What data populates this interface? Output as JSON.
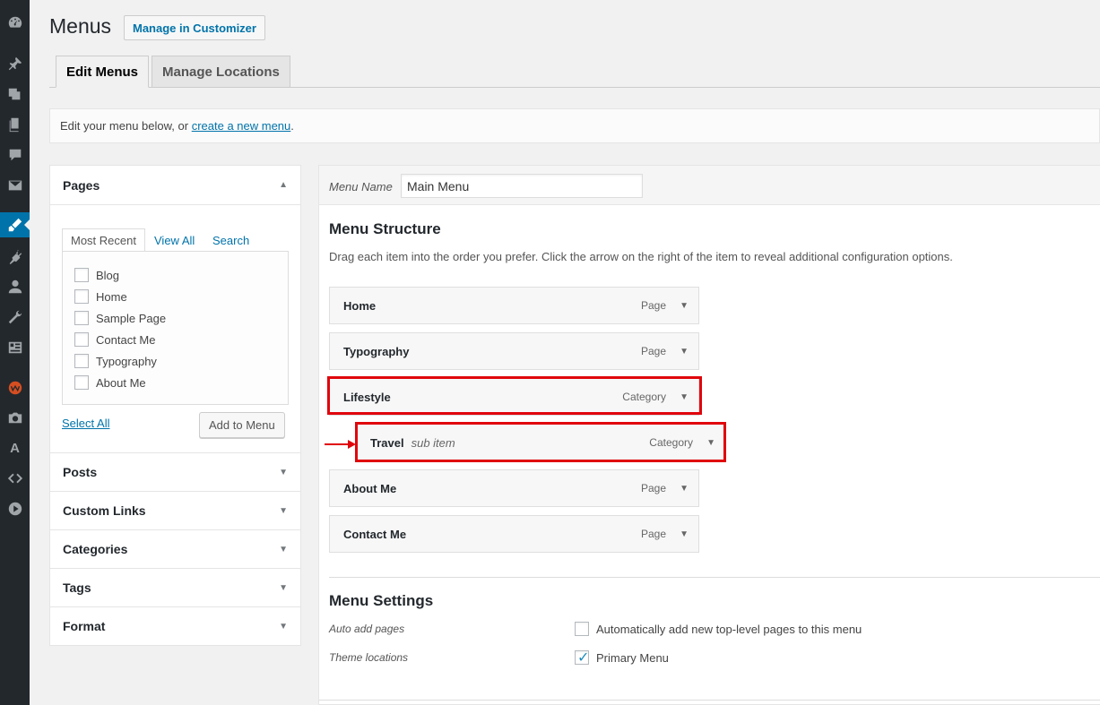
{
  "header": {
    "title": "Menus",
    "customizer_button": "Manage in Customizer"
  },
  "tabs": [
    {
      "label": "Edit Menus",
      "active": true
    },
    {
      "label": "Manage Locations",
      "active": false
    }
  ],
  "notice": {
    "prefix": "Edit your menu below, or ",
    "link": "create a new menu",
    "suffix": "."
  },
  "sidebar": {
    "icons": [
      "dashboard-icon",
      "pin-icon",
      "media-icon",
      "pages-icon",
      "comments-icon",
      "mail-icon",
      "appearance-icon",
      "plugins-icon",
      "users-icon",
      "tools-icon",
      "settings-icon",
      "plugin-badge-icon",
      "camera-icon",
      "font-icon",
      "code-icon",
      "play-icon"
    ],
    "font_letter": "A",
    "active": "appearance-icon"
  },
  "pages_box": {
    "title": "Pages",
    "tabs": [
      "Most Recent",
      "View All",
      "Search"
    ],
    "items": [
      "Blog",
      "Home",
      "Sample Page",
      "Contact Me",
      "Typography",
      "About Me"
    ],
    "select_all": "Select All",
    "add_button": "Add to Menu"
  },
  "accordion": [
    "Posts",
    "Custom Links",
    "Categories",
    "Tags",
    "Format"
  ],
  "menu_name": {
    "label": "Menu Name",
    "value": "Main Menu"
  },
  "menu_structure": {
    "title": "Menu Structure",
    "description": "Drag each item into the order you prefer. Click the arrow on the right of the item to reveal additional configuration options.",
    "items": [
      {
        "title": "Home",
        "type": "Page",
        "sub": ""
      },
      {
        "title": "Typography",
        "type": "Page",
        "sub": ""
      },
      {
        "title": "Lifestyle",
        "type": "Category",
        "sub": ""
      },
      {
        "title": "Travel",
        "type": "Category",
        "sub": "sub item"
      },
      {
        "title": "About Me",
        "type": "Page",
        "sub": ""
      },
      {
        "title": "Contact Me",
        "type": "Page",
        "sub": ""
      }
    ]
  },
  "menu_settings": {
    "title": "Menu Settings",
    "auto_add_label": "Auto add pages",
    "auto_add_option": "Automatically add new top-level pages to this menu",
    "auto_add_checked": false,
    "theme_locations_label": "Theme locations",
    "theme_location_option": "Primary Menu",
    "theme_location_checked": true
  },
  "colors": {
    "accent": "#0073aa",
    "highlight": "#e0050c",
    "sidebar_bg": "#23282d"
  }
}
